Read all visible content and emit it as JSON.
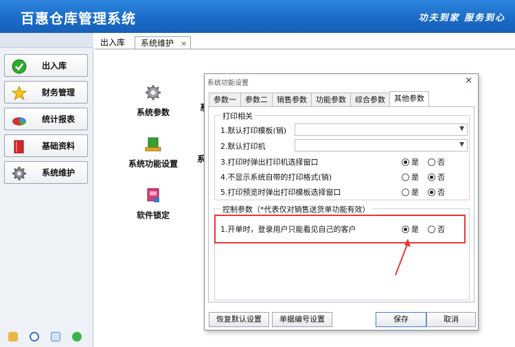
{
  "app": {
    "title": "百惠仓库管理系统",
    "slogan": "功夫到家 服务到心"
  },
  "sidebar": {
    "items": [
      {
        "label": "出入库",
        "icon": "check-circle-icon"
      },
      {
        "label": "财务管理",
        "icon": "star-icon"
      },
      {
        "label": "统计报表",
        "icon": "pie-chart-icon"
      },
      {
        "label": "基础资料",
        "icon": "book-icon"
      },
      {
        "label": "系统维护",
        "icon": "gear-icon"
      }
    ],
    "status_icons": [
      "edit-icon",
      "clock-icon",
      "search-icon",
      "refresh-icon"
    ]
  },
  "tabs": {
    "items": [
      {
        "label": "出入库"
      },
      {
        "label": "系统维护",
        "close": "×"
      }
    ]
  },
  "functions": {
    "items": [
      {
        "label": "系统参数",
        "icon": "gear-icon"
      },
      {
        "label": "系统功能设置",
        "icon": "green-cube-icon"
      },
      {
        "label": "软件锁定",
        "icon": "lock-app-icon"
      }
    ],
    "cut_labels": [
      "系",
      "系"
    ]
  },
  "dialog": {
    "title": "系统功能设置",
    "close": "×",
    "tabs": [
      "参数一",
      "参数二",
      "销售参数",
      "功能参数",
      "综合参数",
      "其他参数"
    ],
    "active_tab": "其他参数",
    "print_group": {
      "legend": "打印相关",
      "rows": [
        {
          "label": "1.默认打印模板(销)",
          "type": "combo",
          "value": ""
        },
        {
          "label": "2.默认打印机",
          "type": "combo",
          "value": ""
        },
        {
          "label": "3.打印时弹出打印机选择窗口",
          "type": "radio",
          "yes": "是",
          "no": "否",
          "selected": "yes"
        },
        {
          "label": "4.不显示系统自带的打印格式(销)",
          "type": "radio",
          "yes": "是",
          "no": "否",
          "selected": "no"
        },
        {
          "label": "5.打印预览时弹出打印模板选择窗口",
          "type": "radio",
          "yes": "是",
          "no": "否",
          "selected": "no"
        }
      ]
    },
    "control_group": {
      "legend": "控制参数（*代表仅对销售送货单功能有效）",
      "rows": [
        {
          "label": "1.开单时，登录用户只能看见自己的客户",
          "yes": "是",
          "no": "否",
          "selected": "yes"
        }
      ]
    },
    "buttons": {
      "reset": "恢复默认设置",
      "numbering": "单据编号设置",
      "save": "保存",
      "cancel": "取消"
    }
  },
  "colors": {
    "header": "#1a6cc8",
    "highlight": "#e33333"
  }
}
